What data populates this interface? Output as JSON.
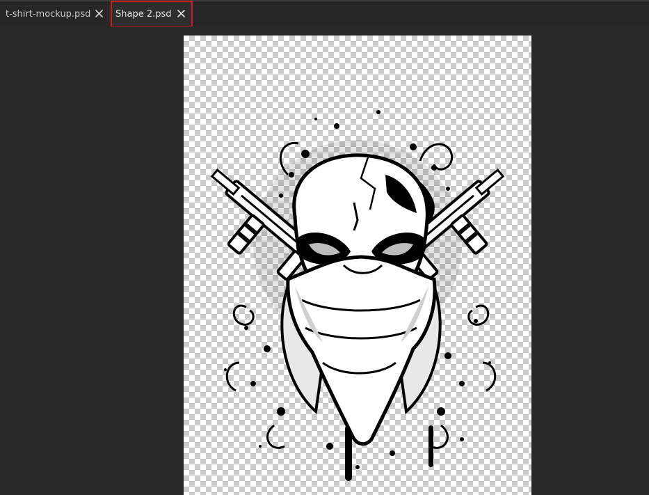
{
  "tabs": [
    {
      "label": "t-shirt-mockup.psd",
      "close_icon": "close-icon",
      "active": false
    },
    {
      "label": "Shape 2.psd",
      "close_icon": "close-icon",
      "active": true,
      "highlight_color": "#d21b1b"
    }
  ],
  "canvas": {
    "background": "#282828",
    "document_background": "transparent-checkerboard",
    "artwork": "skull-with-bandana-and-crossed-guns"
  },
  "colors": {
    "tabbar": "#262626",
    "tab_text": "#c9c9c9",
    "highlight": "#d21b1b"
  }
}
